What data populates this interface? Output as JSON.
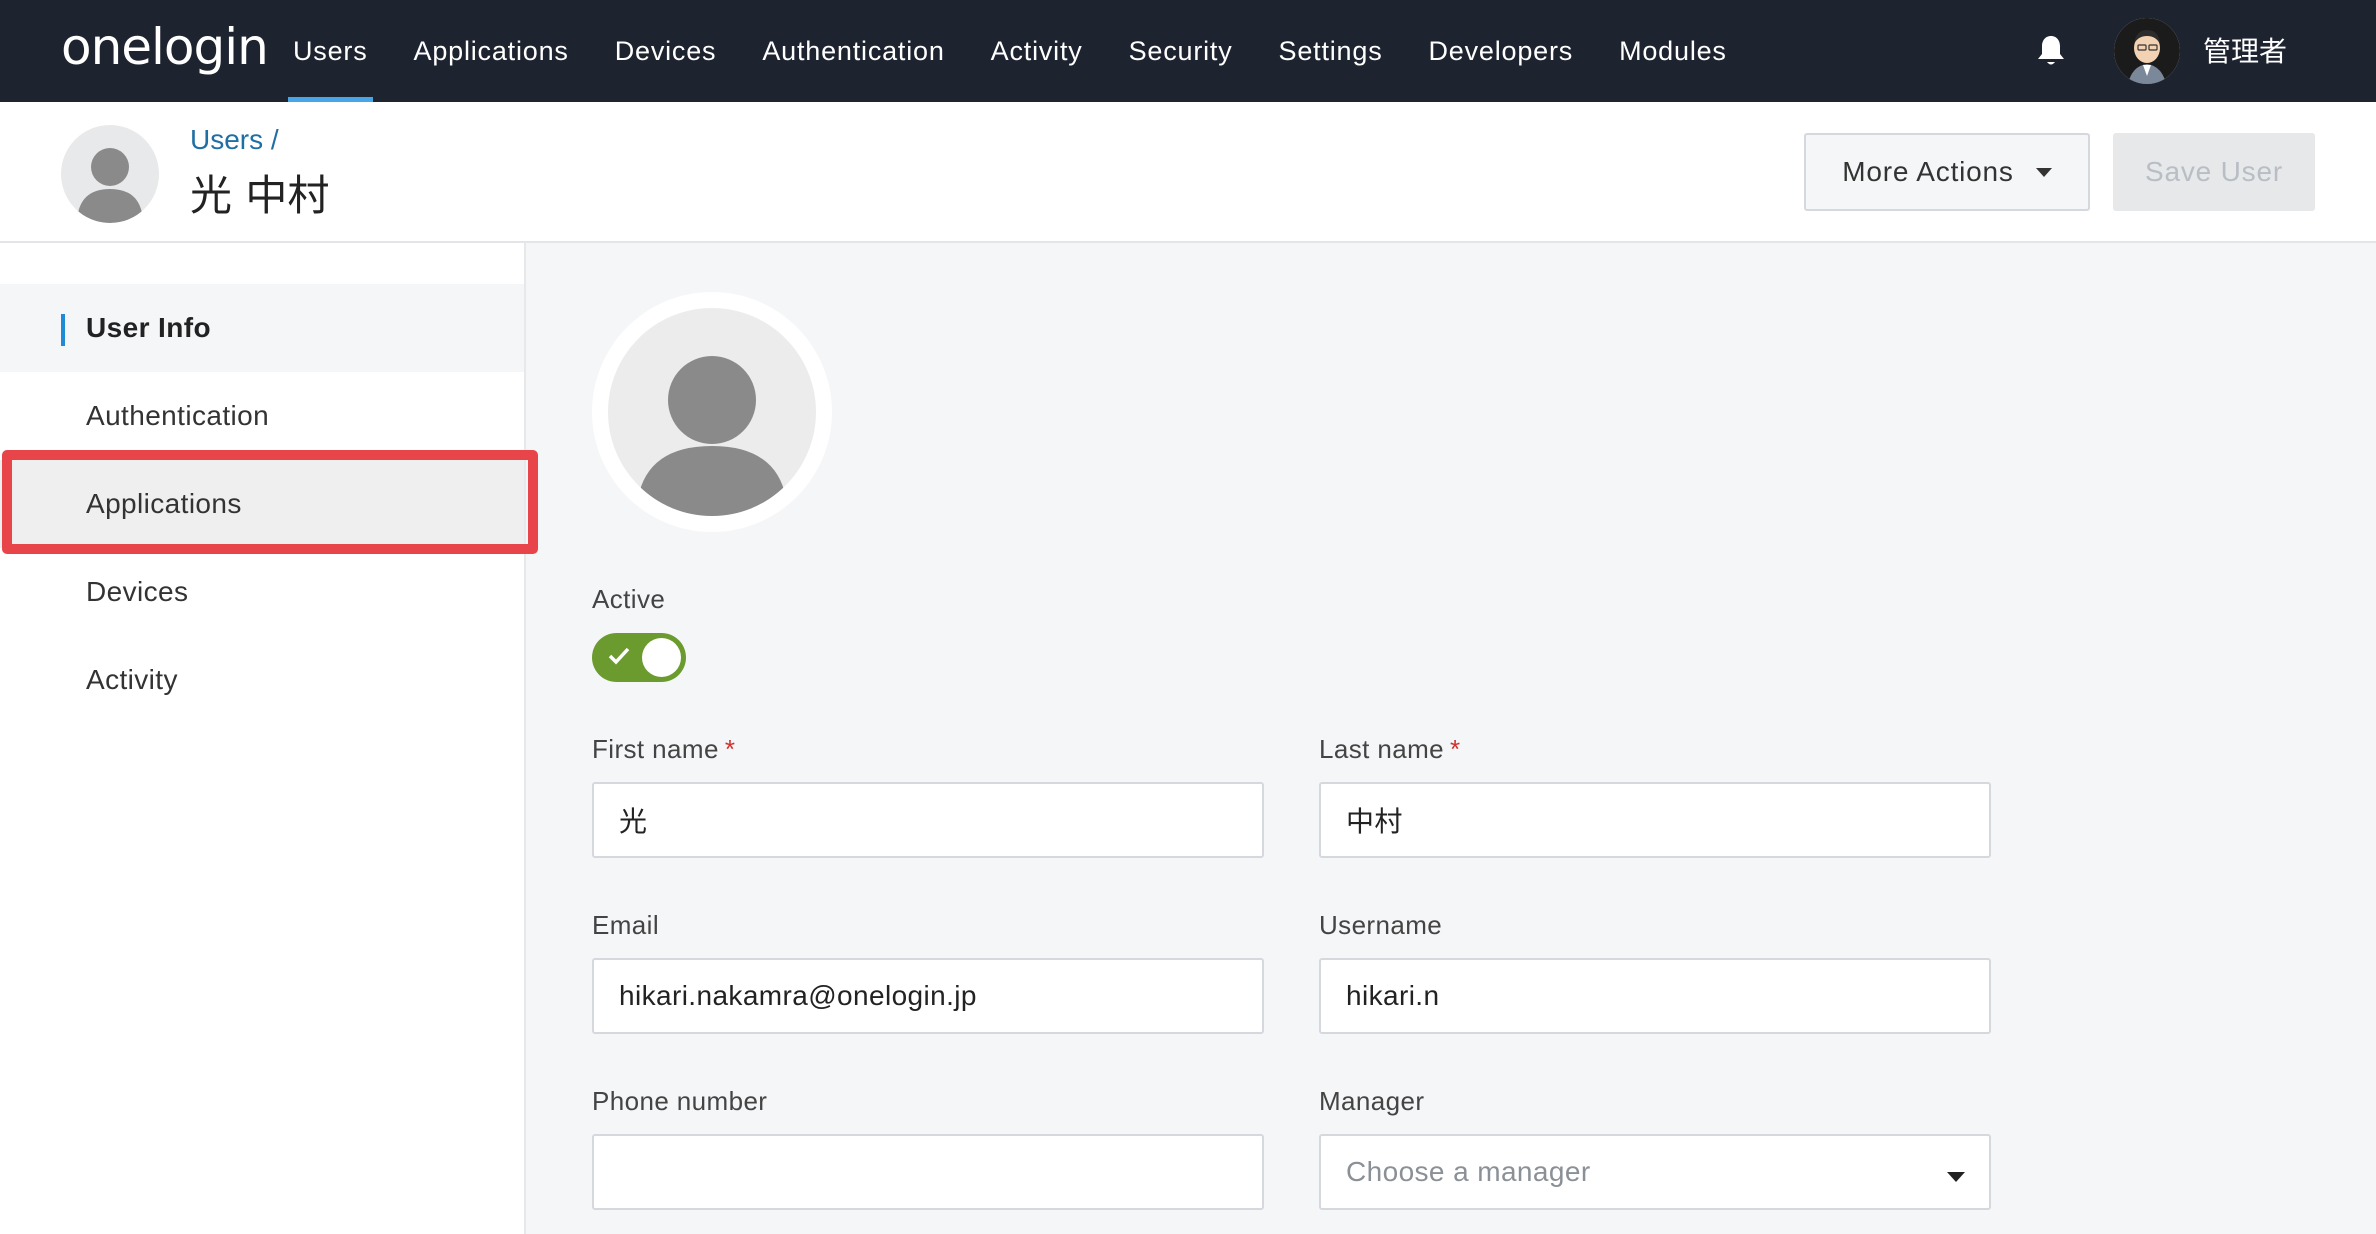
{
  "nav": {
    "logo": "onelogin",
    "items": [
      {
        "label": "Users"
      },
      {
        "label": "Applications"
      },
      {
        "label": "Devices"
      },
      {
        "label": "Authentication"
      },
      {
        "label": "Activity"
      },
      {
        "label": "Security"
      },
      {
        "label": "Settings"
      },
      {
        "label": "Developers"
      },
      {
        "label": "Modules"
      }
    ],
    "active": "Users",
    "bell_icon": "bell-icon",
    "user_name": "管理者"
  },
  "header": {
    "breadcrumb": "Users /",
    "title": "光 中村",
    "more_actions_label": "More Actions",
    "save_label": "Save User"
  },
  "sidebar": {
    "items": [
      {
        "label": "User Info"
      },
      {
        "label": "Authentication"
      },
      {
        "label": "Applications"
      },
      {
        "label": "Devices"
      },
      {
        "label": "Activity"
      }
    ],
    "active": "User Info",
    "highlighted": "Applications"
  },
  "form": {
    "active_label": "Active",
    "active_on": true,
    "first_name_label": "First name",
    "first_name_value": "光",
    "last_name_label": "Last name",
    "last_name_value": "中村",
    "required_mark": "*",
    "email_label": "Email",
    "email_value": "hikari.nakamra@onelogin.jp",
    "username_label": "Username",
    "username_value": "hikari.n",
    "phone_label": "Phone number",
    "phone_value": "",
    "manager_label": "Manager",
    "manager_placeholder": "Choose a manager"
  },
  "colors": {
    "nav_bg": "#1e2330",
    "accent": "#46a6e8",
    "toggle_on": "#6b9b2f",
    "highlight": "#e8454a",
    "link": "#1f6fa5"
  }
}
